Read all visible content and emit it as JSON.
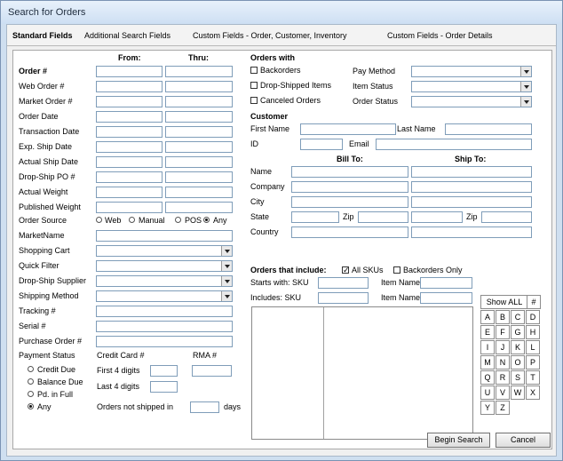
{
  "window": {
    "title": "Search for Orders"
  },
  "tabs": [
    "Standard Fields",
    "Additional Search Fields",
    "Custom Fields - Order, Customer, Inventory",
    "Custom Fields - Order Details"
  ],
  "left": {
    "from_label": "From:",
    "thru_label": "Thru:",
    "range_fields": [
      "Order #",
      "Web Order #",
      "Market Order #",
      "Order Date",
      "Transaction Date",
      "Exp. Ship Date",
      "Actual Ship Date",
      "Drop-Ship PO #",
      "Actual Weight",
      "Published Weight"
    ],
    "order_source": {
      "label": "Order Source",
      "options": [
        "Web",
        "Manual",
        "POS",
        "Any"
      ],
      "selected": "Any"
    },
    "marketname_label": "MarketName",
    "selects": [
      "Shopping Cart",
      "Quick Filter",
      "Drop-Ship Supplier",
      "Shipping Method"
    ],
    "text_fields": [
      "Tracking #",
      "Serial #",
      "Purchase Order #"
    ],
    "payment_status": {
      "label": "Payment Status",
      "options": [
        "Credit Due",
        "Balance Due",
        "Pd. in Full",
        "Any"
      ],
      "selected": "Any"
    },
    "credit_card_label": "Credit Card #",
    "rma_label": "RMA #",
    "first4_label": "First 4 digits",
    "last4_label": "Last 4 digits",
    "not_shipped_label": "Orders not shipped in",
    "days_label": "days"
  },
  "right": {
    "orders_with_label": "Orders with",
    "checks": [
      "Backorders",
      "Drop-Shipped Items",
      "Canceled Orders"
    ],
    "status_selects": [
      "Pay Method",
      "Item Status",
      "Order Status"
    ],
    "customer_label": "Customer",
    "first_name_label": "First Name",
    "last_name_label": "Last Name",
    "id_label": "ID",
    "email_label": "Email",
    "bill_to_label": "Bill To:",
    "ship_to_label": "Ship To:",
    "addr_fields": [
      "Name",
      "Company",
      "City",
      "State",
      "Country"
    ],
    "zip_label": "Zip",
    "orders_include_label": "Orders that include:",
    "all_skus_label": "All SKUs",
    "backorders_only_label": "Backorders Only",
    "starts_with_label": "Starts with: SKU",
    "includes_label": "Includes: SKU",
    "item_name_label": "Item Name"
  },
  "keypad": {
    "show_all": "Show ALL",
    "hash": "#",
    "letters": [
      "A",
      "B",
      "C",
      "D",
      "E",
      "F",
      "G",
      "H",
      "I",
      "J",
      "K",
      "L",
      "M",
      "N",
      "O",
      "P",
      "Q",
      "R",
      "S",
      "T",
      "U",
      "V",
      "W",
      "X",
      "Y",
      "Z"
    ]
  },
  "buttons": {
    "begin_search": "Begin Search",
    "cancel": "Cancel"
  }
}
